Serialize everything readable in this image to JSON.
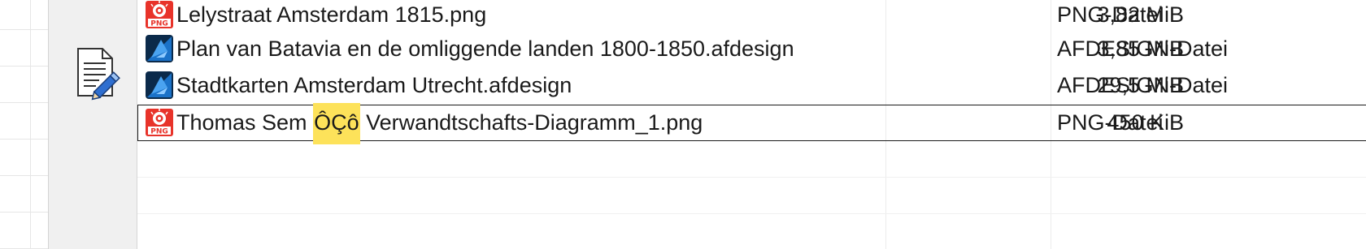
{
  "files": [
    {
      "name_pre": "Lelystraat Amsterdam 1815.png",
      "name_hl": "",
      "name_post": "",
      "size": "3,82 MiB",
      "type": "PNG-Datei",
      "icon": "png-file-icon"
    },
    {
      "name_pre": "Plan van Batavia en de omliggende landen 1800-1850.afdesign",
      "name_hl": "",
      "name_post": "",
      "size": "3,85 MiB",
      "type": "AFDESIGN-Datei",
      "icon": "affinity-designer-file-icon"
    },
    {
      "name_pre": "Stadtkarten Amsterdam Utrecht.afdesign",
      "name_hl": "",
      "name_post": "",
      "size": "29,5 MiB",
      "type": "AFDESIGN-Datei",
      "icon": "affinity-designer-file-icon"
    },
    {
      "name_pre": "Thomas Sem ",
      "name_hl": "ÔÇô",
      "name_post": " Verwandtschafts-Diagramm_1.png",
      "size": "450 KiB",
      "type": "PNG-Datei",
      "icon": "png-file-icon",
      "focused": true
    }
  ],
  "icons": {
    "png_badge_text": "PNG",
    "side_panel_icon": "document-edit-icon"
  },
  "colors": {
    "highlight": "#fde25a",
    "png_red": "#e8332a",
    "afdesign_blue": "#1b72c8",
    "afdesign_dark": "#0b2a4a"
  }
}
